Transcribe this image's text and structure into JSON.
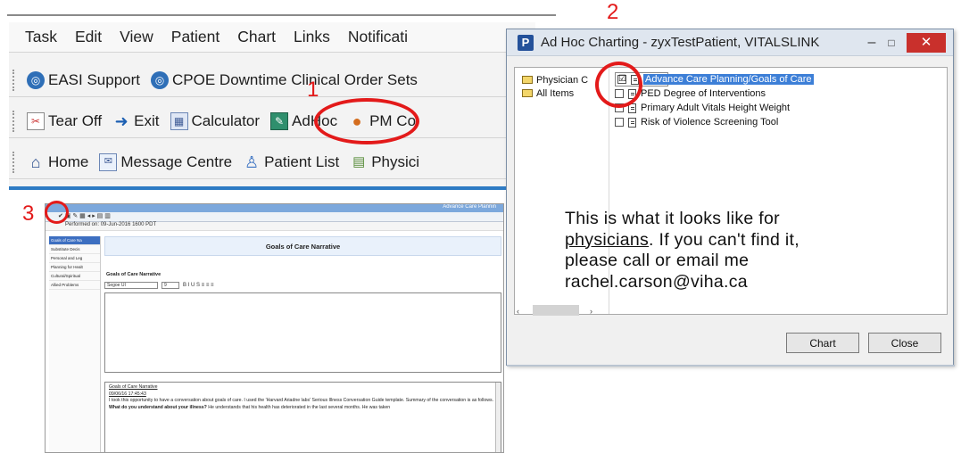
{
  "cerner": {
    "menu": [
      "Task",
      "Edit",
      "View",
      "Patient",
      "Chart",
      "Links",
      "Notificati"
    ],
    "toolbar1": {
      "easi": "EASI Support",
      "cpoe": "CPOE Downtime Clinical Order Sets"
    },
    "toolbar2": {
      "tearoff": "Tear Off",
      "exit": "Exit",
      "calculator": "Calculator",
      "adhoc": "AdHoc",
      "pm": "PM Co"
    },
    "toolbar3": {
      "home": "Home",
      "message": "Message Centre",
      "patient_list": "Patient List",
      "physici": "Physici"
    }
  },
  "goc": {
    "window_title": "Advance Care Plannin",
    "date_label": "Performed on:",
    "date_value": "09-Jun-2016",
    "time_value": "1600",
    "tz": "PDT",
    "side_items": [
      "Goals of Care Na",
      "Substitute Decis",
      "Personal and Leg",
      "Planning for Healt",
      "Cultural/Spiritual",
      "Allied Problems"
    ],
    "form_title": "Goals of Care Narrative",
    "section_label": "Goals of Care Narrative",
    "font": "Segoe UI",
    "font_size": "9",
    "fmt_buttons": "B I U  S  ≡ ≡ ≡",
    "note_title": "Goals of Care Narrative",
    "note_time": "09/06/16 17:45:43",
    "note_text": "I took this opportunity to have a conversation about goals of care. I used the 'Harvard Ariadne labs' Serious Illness Conversation Guide template. Summary of the conversation is as follows.",
    "note_q": "What do you understand about your illness?",
    "note_q_ans": "He understands that his health has deteriorated in the last several months. He was taken"
  },
  "dialog": {
    "title": "Ad Hoc Charting - zyxTestPatient, VITALSLINK",
    "app_icon": "P",
    "min": "–",
    "max": "□",
    "close": "✕",
    "tree": [
      "Physician C",
      "All Items"
    ],
    "items": [
      {
        "label": "Advance Care Planning/Goals of Care",
        "checked": "☑"
      },
      {
        "label": "PED Degree of Interventions",
        "checked": ""
      },
      {
        "label": "Primary Adult Vitals Height Weight",
        "checked": ""
      },
      {
        "label": "Risk of Violence Screening Tool",
        "checked": ""
      }
    ],
    "note": {
      "line1": "This is what it looks like for",
      "link": "physicians",
      "line2_rest": ". If you can't find it,",
      "line3": "please call or email me",
      "line4": "rachel.carson@viha.ca"
    },
    "scroll_left": "‹",
    "scroll_right": "›",
    "chart_button": "Chart",
    "close_button": "Close"
  },
  "annotations": {
    "one": "1",
    "two": "2",
    "three": "3",
    "accent": "#e31a1a"
  }
}
